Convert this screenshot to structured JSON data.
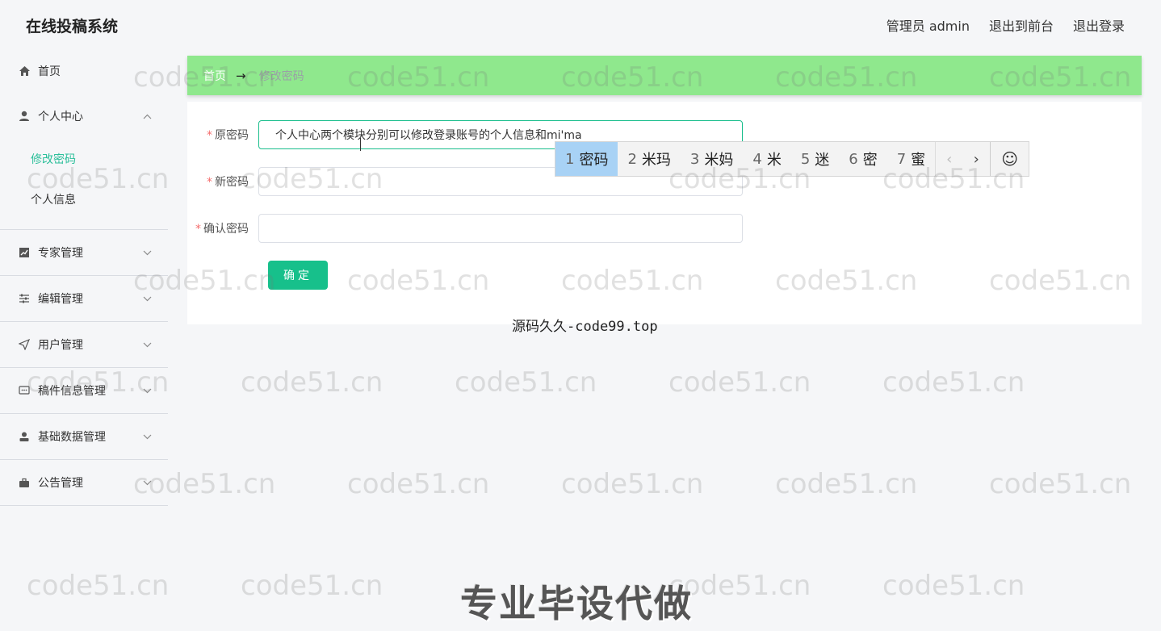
{
  "app": {
    "title": "在线投稿系统"
  },
  "header": {
    "admin_label": "管理员 admin",
    "front_label": "退出到前台",
    "logout_label": "退出登录"
  },
  "sidebar": {
    "items": [
      {
        "label": "首页",
        "icon": "home-icon"
      },
      {
        "label": "个人中心",
        "icon": "user-icon",
        "expanded": true,
        "children": [
          {
            "label": "修改密码",
            "active": true
          },
          {
            "label": "个人信息"
          }
        ]
      },
      {
        "label": "专家管理",
        "icon": "chart-icon"
      },
      {
        "label": "编辑管理",
        "icon": "sliders-icon"
      },
      {
        "label": "用户管理",
        "icon": "send-icon"
      },
      {
        "label": "稿件信息管理",
        "icon": "message-icon"
      },
      {
        "label": "基础数据管理",
        "icon": "person-icon"
      },
      {
        "label": "公告管理",
        "icon": "briefcase-icon"
      }
    ]
  },
  "breadcrumb": {
    "home": "首页",
    "arrow": "→",
    "current": "修改密码"
  },
  "form": {
    "required_mark": "*",
    "old_password": {
      "label": "原密码",
      "value": "个人中心两个模块分别可以修改登录账号的个人信息和mi'ma"
    },
    "new_password": {
      "label": "新密码",
      "value": ""
    },
    "confirm_password": {
      "label": "确认密码",
      "value": ""
    },
    "submit_label": "确定"
  },
  "ime": {
    "candidates": [
      {
        "num": "1",
        "text": "密码"
      },
      {
        "num": "2",
        "text": "米玛"
      },
      {
        "num": "3",
        "text": "米妈"
      },
      {
        "num": "4",
        "text": "米"
      },
      {
        "num": "5",
        "text": "迷"
      },
      {
        "num": "6",
        "text": "密"
      },
      {
        "num": "7",
        "text": "蜜"
      }
    ],
    "prev": "‹",
    "next": "›",
    "emoji": "☺",
    "selected_index": 0
  },
  "watermarks": {
    "site": "code51.cn",
    "code99": "源码久久-code99.top",
    "banner": "专业毕设代做"
  },
  "colors": {
    "accent": "#17c08b",
    "breadcrumb_bg": "#8fe88d",
    "required": "#f56c6c",
    "ime_selected": "#a8d2f5"
  }
}
